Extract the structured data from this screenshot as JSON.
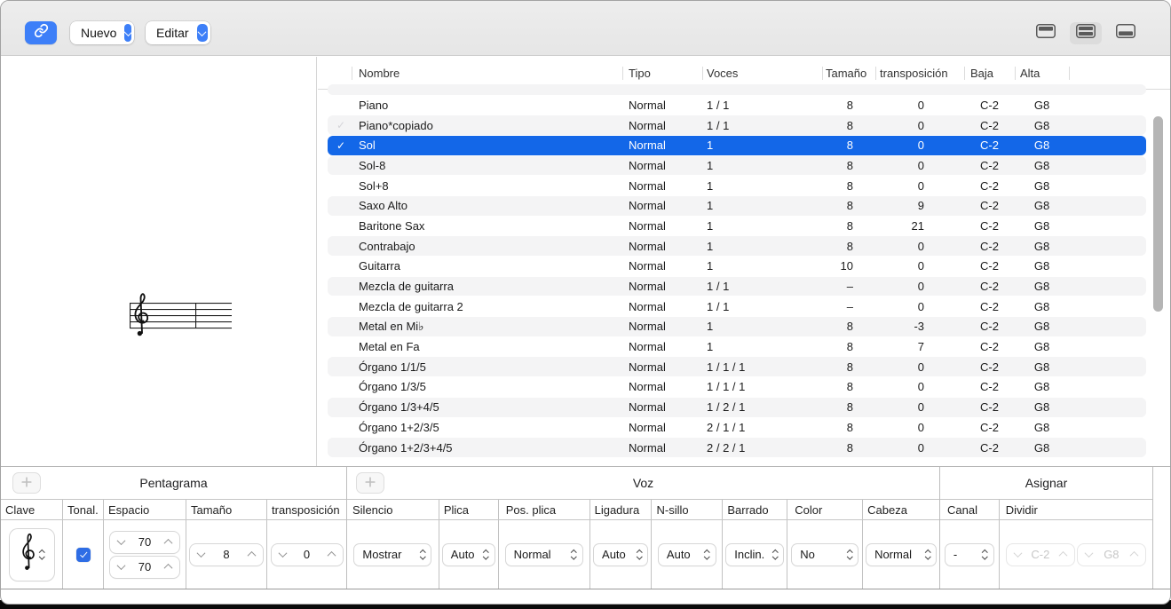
{
  "toolbar": {
    "new_label": "Nuevo",
    "edit_label": "Editar"
  },
  "icons": {
    "link_button": "link-icon",
    "dropdown": "chevron-down-icon",
    "view_modes": [
      "layout-top-pane-icon",
      "layout-split-icon",
      "layout-bottom-pane-icon"
    ],
    "clef": "treble-clef-icon",
    "checkmark": "check-icon",
    "plus": "plus-icon"
  },
  "colors": {
    "selection_blue": "#1367e8",
    "accent_blue": "#3d7ff8",
    "checkbox_blue": "#2e6de5",
    "toolbar_bg": "#e9e9e9",
    "row_stripe": "#f4f4f5"
  },
  "table": {
    "columns": [
      "Nombre",
      "Tipo",
      "Voces",
      "Tamaño",
      "transposición",
      "Baja",
      "Alta"
    ],
    "rows": [
      {
        "name": "Piano",
        "tipo": "Normal",
        "voces": "1 / 1",
        "tamano": "8",
        "transp": "0",
        "baja": "C-2",
        "alta": "G8"
      },
      {
        "name": "Piano*copiado",
        "tipo": "Normal",
        "voces": "1 / 1",
        "tamano": "8",
        "transp": "0",
        "baja": "C-2",
        "alta": "G8",
        "check": "faint"
      },
      {
        "name": "Sol",
        "tipo": "Normal",
        "voces": "1",
        "tamano": "8",
        "transp": "0",
        "baja": "C-2",
        "alta": "G8",
        "selected": true,
        "check": "white"
      },
      {
        "name": "Sol-8",
        "tipo": "Normal",
        "voces": "1",
        "tamano": "8",
        "transp": "0",
        "baja": "C-2",
        "alta": "G8"
      },
      {
        "name": "Sol+8",
        "tipo": "Normal",
        "voces": "1",
        "tamano": "8",
        "transp": "0",
        "baja": "C-2",
        "alta": "G8"
      },
      {
        "name": "Saxo Alto",
        "tipo": "Normal",
        "voces": "1",
        "tamano": "8",
        "transp": "9",
        "baja": "C-2",
        "alta": "G8"
      },
      {
        "name": "Baritone Sax",
        "tipo": "Normal",
        "voces": "1",
        "tamano": "8",
        "transp": "21",
        "baja": "C-2",
        "alta": "G8"
      },
      {
        "name": "Contrabajo",
        "tipo": "Normal",
        "voces": "1",
        "tamano": "8",
        "transp": "0",
        "baja": "C-2",
        "alta": "G8"
      },
      {
        "name": "Guitarra",
        "tipo": "Normal",
        "voces": "1",
        "tamano": "10",
        "transp": "0",
        "baja": "C-2",
        "alta": "G8"
      },
      {
        "name": "Mezcla de guitarra",
        "tipo": "Normal",
        "voces": "1 / 1",
        "tamano": "–",
        "transp": "0",
        "baja": "C-2",
        "alta": "G8"
      },
      {
        "name": "Mezcla de guitarra 2",
        "tipo": "Normal",
        "voces": "1 / 1",
        "tamano": "–",
        "transp": "0",
        "baja": "C-2",
        "alta": "G8"
      },
      {
        "name": "Metal en Mi♭",
        "tipo": "Normal",
        "voces": "1",
        "tamano": "8",
        "transp": "-3",
        "baja": "C-2",
        "alta": "G8"
      },
      {
        "name": "Metal en Fa",
        "tipo": "Normal",
        "voces": "1",
        "tamano": "8",
        "transp": "7",
        "baja": "C-2",
        "alta": "G8"
      },
      {
        "name": "Órgano 1/1/5",
        "tipo": "Normal",
        "voces": "1 / 1 / 1",
        "tamano": "8",
        "transp": "0",
        "baja": "C-2",
        "alta": "G8"
      },
      {
        "name": "Órgano 1/3/5",
        "tipo": "Normal",
        "voces": "1 / 1 / 1",
        "tamano": "8",
        "transp": "0",
        "baja": "C-2",
        "alta": "G8"
      },
      {
        "name": "Órgano 1/3+4/5",
        "tipo": "Normal",
        "voces": "1 / 2 / 1",
        "tamano": "8",
        "transp": "0",
        "baja": "C-2",
        "alta": "G8"
      },
      {
        "name": "Órgano 1+2/3/5",
        "tipo": "Normal",
        "voces": "2 / 1 / 1",
        "tamano": "8",
        "transp": "0",
        "baja": "C-2",
        "alta": "G8"
      },
      {
        "name": "Órgano 1+2/3+4/5",
        "tipo": "Normal",
        "voces": "2 / 2 / 1",
        "tamano": "8",
        "transp": "0",
        "baja": "C-2",
        "alta": "G8"
      }
    ]
  },
  "inspector": {
    "pentagrama": {
      "title": "Pentagrama",
      "labels": {
        "clave": "Clave",
        "tonal": "Tonal.",
        "espacio": "Espacio",
        "tamano": "Tamaño",
        "transposicion": "transposición"
      },
      "espacio_value_1": "70",
      "espacio_value_2": "70",
      "tamano_value": "8",
      "transposicion_value": "0",
      "tonal_checked": true
    },
    "voz": {
      "title": "Voz",
      "labels": {
        "silencio": "Silencio",
        "plica": "Plica",
        "pos_plica": "Pos. plica",
        "ligadura": "Ligadura",
        "nsillo": "N-sillo",
        "barrado": "Barrado",
        "color": "Color",
        "cabeza": "Cabeza"
      },
      "values": {
        "silencio": "Mostrar",
        "plica": "Auto",
        "pos_plica": "Normal",
        "ligadura": "Auto",
        "nsillo": "Auto",
        "barrado": "Inclin.",
        "color": "No",
        "cabeza": "Normal"
      }
    },
    "asignar": {
      "title": "Asignar",
      "labels": {
        "canal": "Canal",
        "dividir": "Dividir"
      },
      "canal_value": "-",
      "dividir_low": "C-2",
      "dividir_high": "G8"
    }
  }
}
